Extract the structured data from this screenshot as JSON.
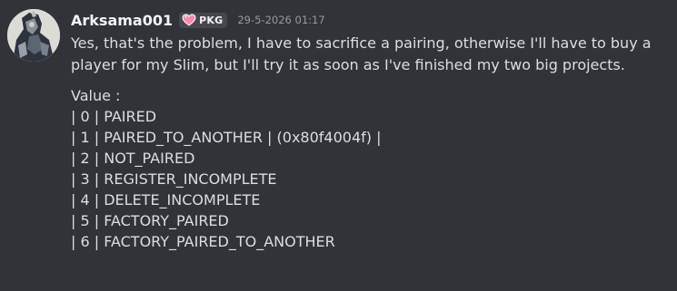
{
  "message": {
    "author": "Arksama001",
    "tag": {
      "icon": "heart-icon",
      "label": "PKG",
      "icon_color": "#f38cae"
    },
    "timestamp": "29-5-2026 01:17",
    "paragraph": "Yes, that's the problem, I have to sacrifice a pairing, otherwise I'll have to buy a player for my Slim, but I'll try it as soon as I've finished my two big projects.",
    "value_lines": [
      "Value :",
      "| 0 | PAIRED",
      "| 1 | PAIRED_TO_ANOTHER | (0x80f4004f) |",
      "| 2 | NOT_PAIRED",
      "| 3 | REGISTER_INCOMPLETE",
      "| 4 | DELETE_INCOMPLETE",
      "| 5 | FACTORY_PAIRED",
      "| 6 | FACTORY_PAIRED_TO_ANOTHER"
    ]
  },
  "colors": {
    "background": "#313338",
    "text": "#dbdee1",
    "username": "#f2f3f5",
    "timestamp": "#949ba4",
    "tag_background": "#46474e"
  }
}
